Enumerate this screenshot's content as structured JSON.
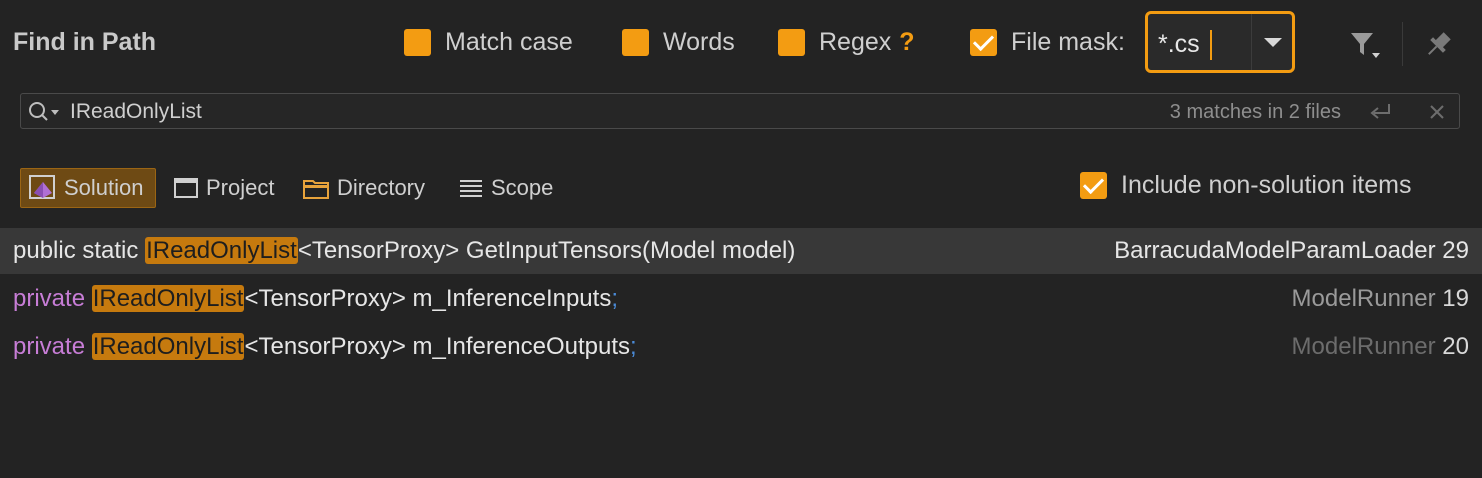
{
  "panel": {
    "title": "Find in Path"
  },
  "options": {
    "match_case": {
      "label": "Match case",
      "checked": false
    },
    "words": {
      "label": "Words",
      "checked": false
    },
    "regex": {
      "label": "Regex",
      "help": "?",
      "checked": false
    },
    "file_mask": {
      "label": "File mask:",
      "checked": true,
      "value": "*.cs"
    }
  },
  "search": {
    "query": "IReadOnlyList",
    "matches": "3 matches in 2 files"
  },
  "scopes": [
    {
      "label": "Solution",
      "active": true
    },
    {
      "label": "Project",
      "active": false
    },
    {
      "label": "Directory",
      "active": false
    },
    {
      "label": "Scope",
      "active": false
    }
  ],
  "include_non_solution": {
    "label": "Include non-solution items",
    "checked": true
  },
  "results": [
    {
      "prefix": "public static ",
      "match": "IReadOnlyList",
      "rest": "<TensorProxy> GetInputTensors(Model model)",
      "terminator": "",
      "file": "BarracudaModelParamLoader",
      "line": "29"
    },
    {
      "prefix": "private ",
      "match": "IReadOnlyList",
      "rest": "<TensorProxy> m_InferenceInputs",
      "terminator": ";",
      "file": "ModelRunner",
      "line": "19"
    },
    {
      "prefix": "private ",
      "match": "IReadOnlyList",
      "rest": "<TensorProxy> m_InferenceOutputs",
      "terminator": ";",
      "file": "ModelRunner",
      "line": "20"
    }
  ],
  "colors": {
    "accent": "#f39c12",
    "keyword": "#c77dd6",
    "highlight": "#c67a0e"
  }
}
